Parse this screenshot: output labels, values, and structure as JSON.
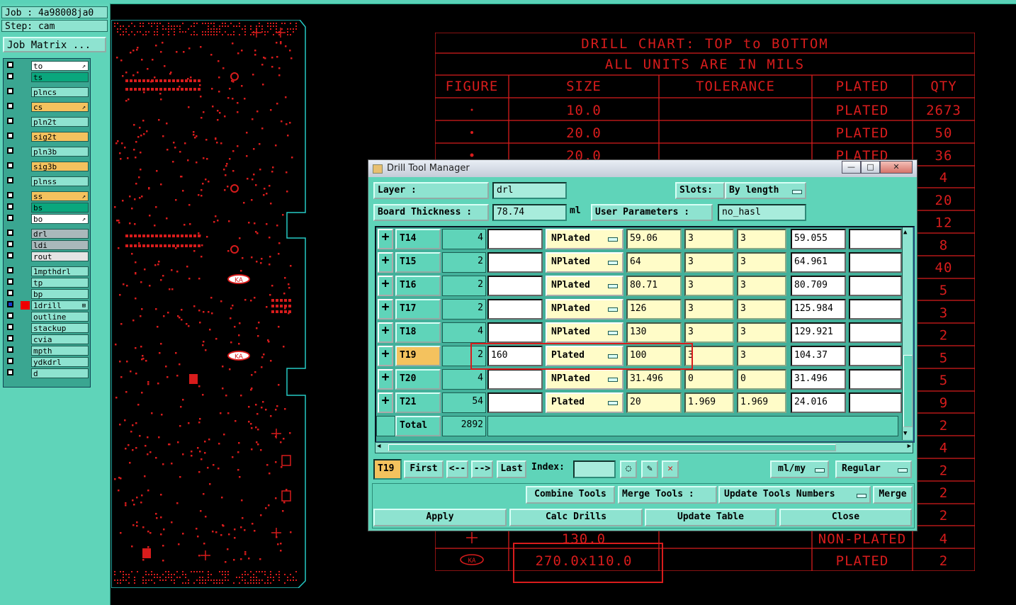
{
  "left_panel": {
    "job": "Job : 4a98008ja0",
    "step": "Step: cam",
    "job_matrix": "Job Matrix ...",
    "layers": [
      {
        "name": "to",
        "color": "#ffffff",
        "mark": "↗"
      },
      {
        "name": "ts",
        "color": "#0aa77d",
        "mark": ""
      },
      {
        "name": "plncs",
        "color": "#8ee3d0",
        "mark": ""
      },
      {
        "name": "cs",
        "color": "#f4c25e",
        "mark": "↗"
      },
      {
        "name": "pln2t",
        "color": "#8ee3d0",
        "mark": ""
      },
      {
        "name": "sig2t",
        "color": "#f4c25e",
        "mark": ""
      },
      {
        "name": "pln3b",
        "color": "#8ee3d0",
        "mark": ""
      },
      {
        "name": "sig3b",
        "color": "#f4c25e",
        "mark": ""
      },
      {
        "name": "plnss",
        "color": "#8ee3d0",
        "mark": ""
      },
      {
        "name": "ss",
        "color": "#f4c25e",
        "mark": "↗"
      },
      {
        "name": "bs",
        "color": "#0aa77d",
        "mark": ""
      },
      {
        "name": "bo",
        "color": "#ffffff",
        "mark": "↗"
      },
      {
        "name": "drl",
        "color": "#a9b8bb",
        "mark": ""
      },
      {
        "name": "ldi",
        "color": "#a9b8bb",
        "mark": ""
      },
      {
        "name": "rout",
        "color": "#e4e4e4",
        "mark": ""
      },
      {
        "name": "1mpthdrl",
        "color": "#8ee3d0",
        "mark": ""
      },
      {
        "name": "tp",
        "color": "#8ee3d0",
        "mark": ""
      },
      {
        "name": "bp",
        "color": "#8ee3d0",
        "mark": ""
      },
      {
        "name": "1drill",
        "color": "#8ee3d0",
        "mark": "⊞"
      },
      {
        "name": "outline",
        "color": "#8ee3d0",
        "mark": ""
      },
      {
        "name": "stackup",
        "color": "#8ee3d0",
        "mark": ""
      },
      {
        "name": "cvia",
        "color": "#8ee3d0",
        "mark": ""
      },
      {
        "name": "mpth",
        "color": "#8ee3d0",
        "mark": ""
      },
      {
        "name": "ydkdrl",
        "color": "#8ee3d0",
        "mark": ""
      },
      {
        "name": "d",
        "color": "#8ee3d0",
        "mark": ""
      }
    ]
  },
  "board": {
    "ka_label_1": "KA",
    "ka_label_2": "KA"
  },
  "drill_chart": {
    "title": "DRILL CHART: TOP to BOTTOM",
    "subtitle": "ALL UNITS ARE IN MILS",
    "headers": [
      "FIGURE",
      "SIZE",
      "TOLERANCE",
      "PLATED",
      "QTY"
    ],
    "rows": [
      {
        "size": "10.0",
        "plated": "PLATED",
        "qty": "2673"
      },
      {
        "size": "20.0",
        "plated": "PLATED",
        "qty": "50"
      },
      {
        "size": "20.0",
        "plated": "PLATED",
        "qty": "36"
      }
    ],
    "qty_column": [
      "4",
      "20",
      "12",
      "8",
      "40",
      "5",
      "3",
      "2",
      "5",
      "5",
      "9",
      "2",
      "4",
      "2",
      "2",
      "2"
    ],
    "bottom_rows": [
      {
        "size": "130.0",
        "plated": "NON-PLATED",
        "qty": "4"
      },
      {
        "figure": "KA",
        "size": "270.0x110.0",
        "plated": "PLATED",
        "qty": "2"
      }
    ]
  },
  "dialog": {
    "title": "Drill Tool Manager",
    "window_buttons": {
      "minimize": "—",
      "maximize": "□",
      "close": "✕"
    },
    "layer_label": "Layer          :",
    "layer_value": "drl",
    "slots_label": "Slots:",
    "slots_value": "By length",
    "board_thickness_label": "Board Thickness  :",
    "board_thickness_value": "78.74",
    "board_thickness_unit": "ml",
    "user_params_label": "User Parameters  :",
    "user_params_value": "no_hasl",
    "rows": [
      {
        "tool": "T14",
        "count": "4",
        "finish": "",
        "type": "NPlated",
        "drill": "59.06",
        "tp": "3",
        "tm": "3",
        "finish_size": "59.055",
        "extra": ""
      },
      {
        "tool": "T15",
        "count": "2",
        "finish": "",
        "type": "NPlated",
        "drill": "64",
        "tp": "3",
        "tm": "3",
        "finish_size": "64.961",
        "extra": ""
      },
      {
        "tool": "T16",
        "count": "2",
        "finish": "",
        "type": "NPlated",
        "drill": "80.71",
        "tp": "3",
        "tm": "3",
        "finish_size": "80.709",
        "extra": ""
      },
      {
        "tool": "T17",
        "count": "2",
        "finish": "",
        "type": "NPlated",
        "drill": "126",
        "tp": "3",
        "tm": "3",
        "finish_size": "125.984",
        "extra": ""
      },
      {
        "tool": "T18",
        "count": "4",
        "finish": "",
        "type": "NPlated",
        "drill": "130",
        "tp": "3",
        "tm": "3",
        "finish_size": "129.921",
        "extra": ""
      },
      {
        "tool": "T19",
        "count": "2",
        "finish": "160",
        "type": "Plated",
        "drill": "100",
        "tp": "3",
        "tm": "3",
        "finish_size": "104.37",
        "extra": "",
        "selected": true
      },
      {
        "tool": "T20",
        "count": "4",
        "finish": "",
        "type": "NPlated",
        "drill": "31.496",
        "tp": "0",
        "tm": "0",
        "finish_size": "31.496",
        "extra": ""
      },
      {
        "tool": "T21",
        "count": "54",
        "finish": "",
        "type": "Plated",
        "drill": "20",
        "tp": "1.969",
        "tm": "1.969",
        "finish_size": "24.016",
        "extra": ""
      }
    ],
    "total_label": "Total",
    "total_value": "2892",
    "nav": {
      "current": "T19",
      "first": "First",
      "prev": "<--",
      "next": "-->",
      "last": "Last",
      "index_label": "Index:",
      "units": "ml/my",
      "mode": "Regular"
    },
    "tools": {
      "combine": "Combine Tools",
      "merge_label": "Merge Tools :",
      "update_numbers": "Update Tools Numbers",
      "merge": "Merge"
    },
    "actions": {
      "apply": "Apply",
      "calc": "Calc Drills",
      "update": "Update Table",
      "close": "Close"
    }
  },
  "colors": {
    "accent_red": "#d81c1c",
    "panel_teal": "#5fd4b9",
    "field_teal": "#8ee3d0",
    "highlight_orange": "#f4c25e"
  }
}
